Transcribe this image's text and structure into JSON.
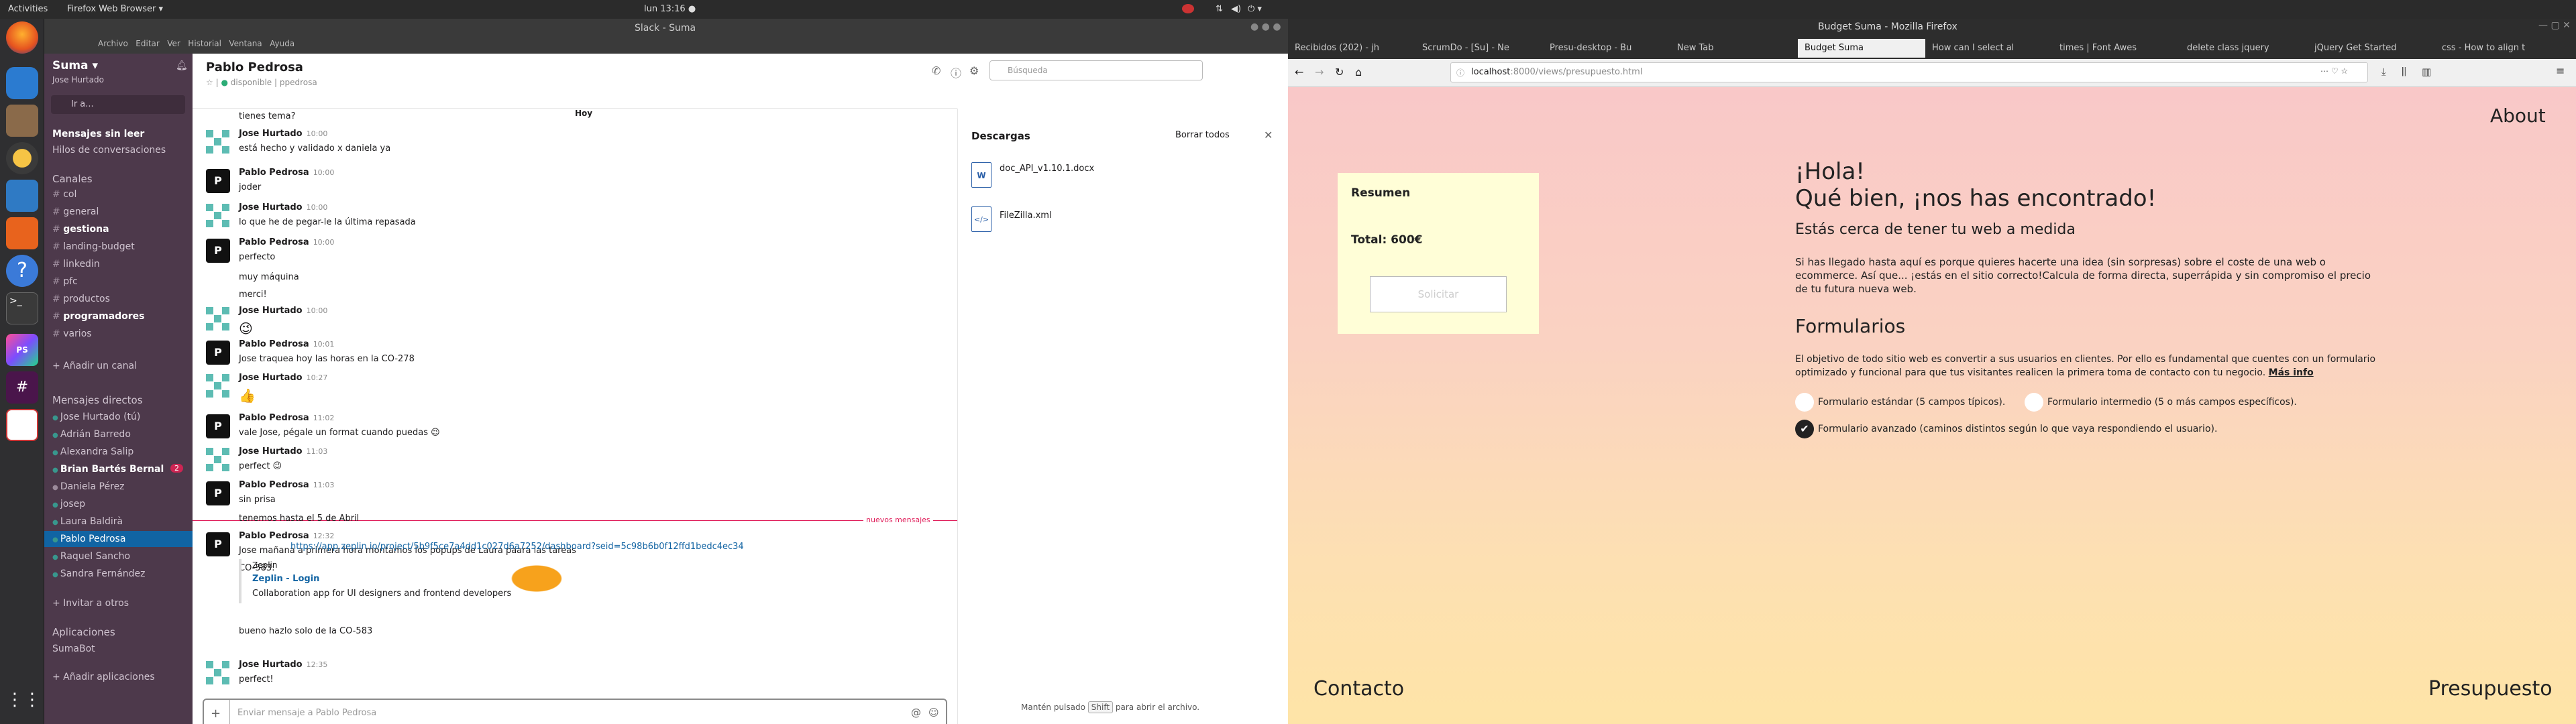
{
  "os": {
    "activities": "Activities",
    "app_menu": "Firefox Web Browser ▾",
    "clock": "lun 13:16 ●"
  },
  "slack": {
    "window_title": "Slack - Suma",
    "workspace": "Suma ▾",
    "user": "Jose Hurtado",
    "jump": "Ir a...",
    "unread": "Mensajes sin leer",
    "threads": "Hilos de conversaciones",
    "channels_title": "Canales",
    "channels": [
      "col",
      "general",
      "gestiona",
      "landing-budget",
      "linkedin",
      "pfc",
      "productos",
      "programadores",
      "varios"
    ],
    "add_channel": "+ Añadir un canal",
    "dm_title": "Mensajes directos",
    "dms": [
      "Jose Hurtado (tú)",
      "Adrián Barredo",
      "Alexandra Salip",
      "Brian Bartés Bernal",
      "Daniela Pérez",
      "josep",
      "Laura Baldirà",
      "Pablo Pedrosa",
      "Raquel Sancho",
      "Sandra Fernández"
    ],
    "dm_badge": "2",
    "invite": "+ Invitar a otros",
    "apps_title": "Aplicaciones",
    "app": "SumaBot",
    "add_apps": "+ Añadir aplicaciones",
    "channel_name": "Pablo Pedrosa",
    "status": "disponible",
    "handle": "ppedrosa",
    "search_placeholder": "Búsqueda",
    "day_divider": "Hoy",
    "new_messages": "nuevos mensajes",
    "messages": [
      {
        "text": "tienes tema?"
      },
      {
        "name": "Jose Hurtado",
        "time": "10:00",
        "text": "está hecho y validado x daniela ya"
      },
      {
        "name": "Pablo Pedrosa",
        "time": "10:00",
        "text": "joder"
      },
      {
        "name": "Jose Hurtado",
        "time": "10:00",
        "text": "lo que he de pegar-le la última repasada"
      },
      {
        "name": "Pablo Pedrosa",
        "time": "10:00",
        "text": "perfecto"
      },
      {
        "text": "muy máquina"
      },
      {
        "text": "merci!"
      },
      {
        "name": "Jose Hurtado",
        "time": "10:00",
        "text": "😉"
      },
      {
        "name": "Pablo Pedrosa",
        "time": "10:01",
        "text": "Jose traqueа hoy las horas en la CO-278"
      },
      {
        "name": "Jose Hurtado",
        "time": "10:27",
        "text": "👍"
      },
      {
        "name": "Pablo Pedrosa",
        "time": "11:02",
        "text": "vale Jose, pégale un format cuando puedas 😉"
      },
      {
        "name": "Jose Hurtado",
        "time": "11:03",
        "text": "perfect 😉"
      },
      {
        "name": "Pablo Pedrosa",
        "time": "11:03",
        "text": "sin prisa"
      },
      {
        "text": "tenemos hasta el 5 de Abril"
      },
      {
        "name": "Pablo Pedrosa",
        "time": "12:32",
        "text": "Jose mañana a primera hora montamos los popups de Laura paara las tareas"
      },
      {
        "text": "CO-583: "
      },
      {
        "text": "bueno hazlo solo de la CO-583"
      },
      {
        "name": "Jose Hurtado",
        "time": "12:35",
        "text": "perfect!"
      }
    ],
    "link": "https://app.zeplin.io/project/5b9f5ce7a4dd1c027d6a7252/dashboard?seid=5c98b6b0f12ffd1bedc4ec34",
    "unfurl_site": "Zeplin",
    "unfurl_title": "Zeplin - Login",
    "unfurl_desc": "Collaboration app for UI designers and frontend developers",
    "composer_placeholder": "Enviar mensaje a Pablo Pedrosa",
    "downloads_title": "Descargas",
    "clear_all": "Borrar todos",
    "files": [
      "doc_API_v1.10.1.docx",
      "FileZilla.xml"
    ],
    "hint_pre": "Mantén pulsado",
    "hint_key": "Shift",
    "hint_post": "para abrir el archivo."
  },
  "firefox": {
    "window_title": "Budget Suma - Mozilla Firefox",
    "tabs": [
      "Recibidos (202) - jh",
      "ScrumDo - [Su] - Ne",
      "Presu-desktop - Bu",
      "New Tab",
      "Budget Suma",
      "How can I select al",
      "times | Font Awes",
      "delete class jquery",
      "jQuery Get Started",
      "css - How to align t"
    ],
    "url_host": "localhost",
    "url_rest": ":8000/views/presupuesto.html",
    "about": "About",
    "summary_title": "Resumen",
    "total": "Total: 600€",
    "request_btn": "Solicitar",
    "hola": "¡Hola!",
    "headline": "Qué bien, ¡nos has encontrado!",
    "subhead": "Estás cerca de tener tu web a medida",
    "intro_1": "Si has llegado hasta aquí es porque quieres hacerte una idea (sin sorpresas) sobre el coste de una web o",
    "intro_2": "ecommerce. Así que... ¡estás en el sitio correcto!Calcula de forma directa, superrápida y sin compromiso el precio",
    "intro_3": "de tu futura nueva web.",
    "forms_title": "Formularios",
    "forms_1": "El objetivo de todo sitio web es convertir a sus usuarios en clientes. Por ello es fundamental que cuentes con un formulario",
    "forms_2": "optimizado y funcional para que tus visitantes realicen la primera toma de contacto con tu negocio.",
    "more_info": "Más info",
    "opt_standard": "Formulario estándar (5 campos típicos).",
    "opt_intermediate": "Formulario intermedio (5 o más campos específicos).",
    "opt_advanced": "Formulario avanzado (caminos distintos según lo que vaya respondiendo el usuario).",
    "contacto": "Contacto",
    "presupuesto": "Presupuesto"
  }
}
